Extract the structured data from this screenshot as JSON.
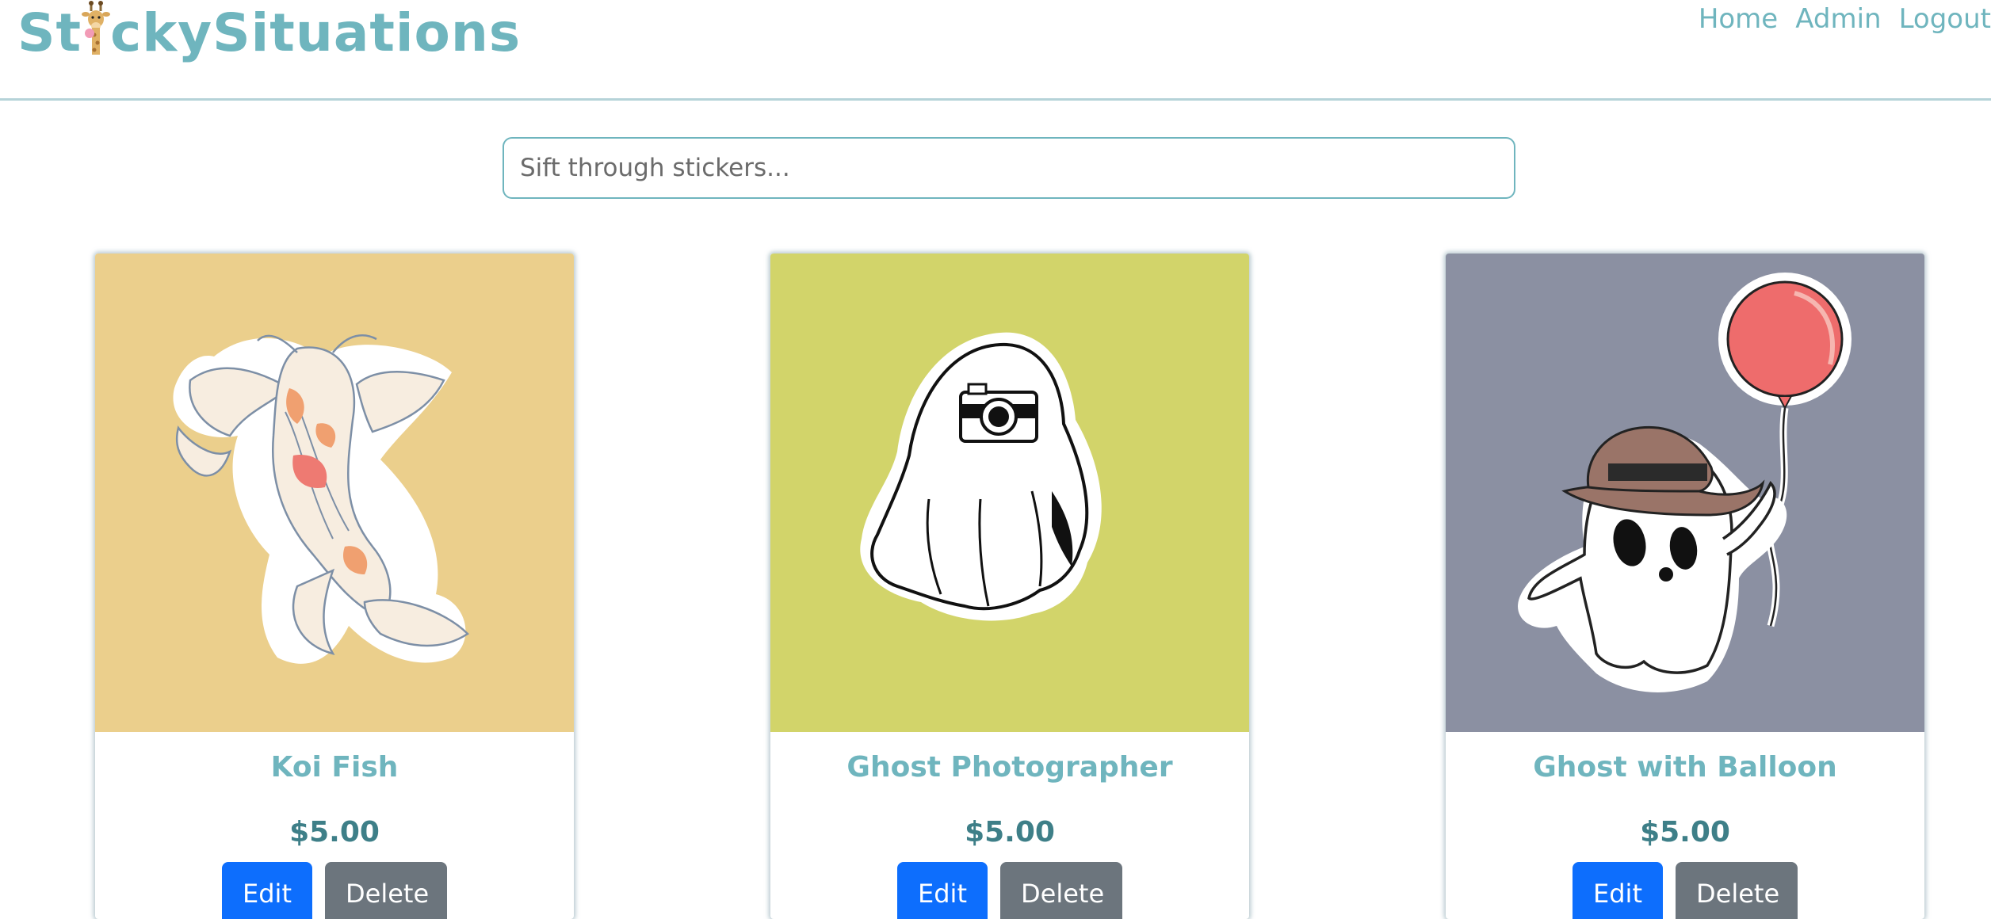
{
  "brand": {
    "name_part1": "St",
    "name_part2": "ckySituations"
  },
  "nav": {
    "home": "Home",
    "admin": "Admin",
    "logout": "Logout"
  },
  "search": {
    "placeholder": "Sift through stickers...",
    "value": ""
  },
  "products": [
    {
      "title": "Koi Fish",
      "price": "$5.00",
      "edit_label": "Edit",
      "delete_label": "Delete",
      "image_bg": "#ebcf8c"
    },
    {
      "title": "Ghost Photographer",
      "price": "$5.00",
      "edit_label": "Edit",
      "delete_label": "Delete",
      "image_bg": "#d2d46a"
    },
    {
      "title": "Ghost with Balloon",
      "price": "$5.00",
      "edit_label": "Edit",
      "delete_label": "Delete",
      "image_bg": "#8b90a2"
    }
  ],
  "colors": {
    "accent": "#6fb5be",
    "price": "#3e7f88",
    "edit_button": "#0d6efd",
    "delete_button": "#6c757d"
  }
}
